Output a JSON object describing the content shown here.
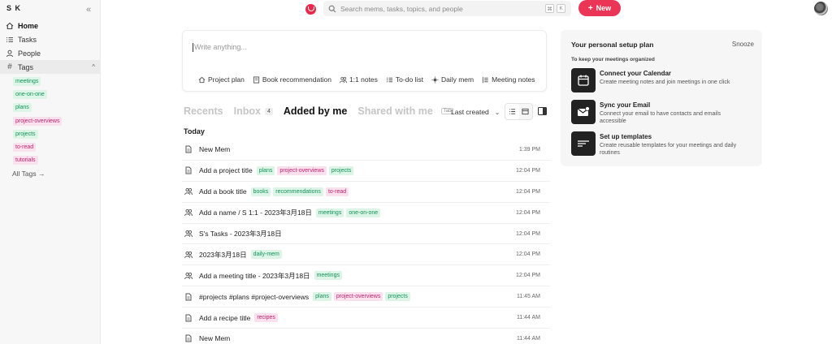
{
  "sidebar": {
    "user_initials": "S K",
    "collapse_icon": "double-chevron-left-icon",
    "nav": [
      {
        "label": "Home",
        "icon": "home-icon",
        "active": true
      },
      {
        "label": "Tasks",
        "icon": "tasks-icon"
      },
      {
        "label": "People",
        "icon": "person-icon"
      }
    ],
    "tags_header": "Tags",
    "tags": [
      {
        "label": "meetings",
        "color": "green"
      },
      {
        "label": "one-on-one",
        "color": "green"
      },
      {
        "label": "plans",
        "color": "green"
      },
      {
        "label": "project-overviews",
        "color": "pink"
      },
      {
        "label": "projects",
        "color": "green"
      },
      {
        "label": "to-read",
        "color": "pink"
      },
      {
        "label": "tutorials",
        "color": "pink"
      }
    ],
    "all_tags": "All Tags →"
  },
  "topbar": {
    "search_placeholder": "Search mems, tasks, topics, and people",
    "kbd1": "⌘",
    "kbd2": "K",
    "new_label": "New",
    "brand_color": "#ea3556"
  },
  "composer": {
    "placeholder": "Write anything...",
    "templates": [
      {
        "label": "Project plan",
        "icon": "house-icon"
      },
      {
        "label": "Book recommendation",
        "icon": "book-icon"
      },
      {
        "label": "1:1 notes",
        "icon": "people-icon"
      },
      {
        "label": "To-do list",
        "icon": "checklist-icon"
      },
      {
        "label": "Daily mem",
        "icon": "sun-icon"
      },
      {
        "label": "Meeting notes",
        "icon": "notes-icon"
      }
    ]
  },
  "tabs": {
    "recents": "Recents",
    "inbox": "Inbox",
    "inbox_count": "4",
    "added_by_me": "Added by me",
    "shared_with_me": "Shared with me",
    "shared_badge": "Tab",
    "sort_label": "Last created"
  },
  "list": {
    "section": "Today",
    "rows": [
      {
        "title": "New Mem",
        "icon": "doc-icon",
        "tags": [],
        "time": "1:39 PM"
      },
      {
        "title": "Add a project title",
        "icon": "doc-icon",
        "tags": [
          {
            "label": "plans",
            "color": "green"
          },
          {
            "label": "project-overviews",
            "color": "pink"
          },
          {
            "label": "projects",
            "color": "green"
          }
        ],
        "time": "12:04 PM"
      },
      {
        "title": "Add a book title",
        "icon": "people-icon",
        "tags": [
          {
            "label": "books",
            "color": "green"
          },
          {
            "label": "recommendations",
            "color": "green"
          },
          {
            "label": "to-read",
            "color": "pink"
          }
        ],
        "time": "12:04 PM"
      },
      {
        "title": "Add a name / S 1:1 - 2023年3月18日",
        "icon": "people-icon",
        "tags": [
          {
            "label": "meetings",
            "color": "green"
          },
          {
            "label": "one-on-one",
            "color": "green"
          }
        ],
        "time": "12:04 PM"
      },
      {
        "title": "S's Tasks - 2023年3月18日",
        "icon": "people-icon",
        "tags": [],
        "time": "12:04 PM"
      },
      {
        "title": "2023年3月18日",
        "icon": "people-icon",
        "tags": [
          {
            "label": "daily-mem",
            "color": "green"
          }
        ],
        "time": "12:04 PM"
      },
      {
        "title": "Add a meeting title - 2023年3月18日",
        "icon": "people-icon",
        "tags": [
          {
            "label": "meetings",
            "color": "green"
          }
        ],
        "time": "12:04 PM"
      },
      {
        "title": "#projects #plans #project-overviews",
        "icon": "doc-icon",
        "tags": [
          {
            "label": "plans",
            "color": "green"
          },
          {
            "label": "project-overviews",
            "color": "pink"
          },
          {
            "label": "projects",
            "color": "green"
          }
        ],
        "time": "11:45 AM"
      },
      {
        "title": "Add a recipe title",
        "icon": "doc-icon",
        "tags": [
          {
            "label": "recipes",
            "color": "pink"
          }
        ],
        "time": "11:44 AM"
      },
      {
        "title": "New Mem",
        "icon": "doc-icon",
        "tags": [],
        "time": "11:44 AM"
      }
    ]
  },
  "setup": {
    "title": "Your personal setup plan",
    "snooze": "Snooze",
    "subtitle": "To keep your meetings organized",
    "items": [
      {
        "title": "Connect your Calendar",
        "desc": "Create meeting notes and join meetings in one click",
        "icon": "calendar-icon"
      },
      {
        "title": "Sync your Email",
        "desc": "Connect your email to have contacts and emails accessible",
        "icon": "email-icon"
      },
      {
        "title": "Set up templates",
        "desc": "Create reusable templates for your meetings and daily routines",
        "icon": "template-icon"
      }
    ]
  }
}
